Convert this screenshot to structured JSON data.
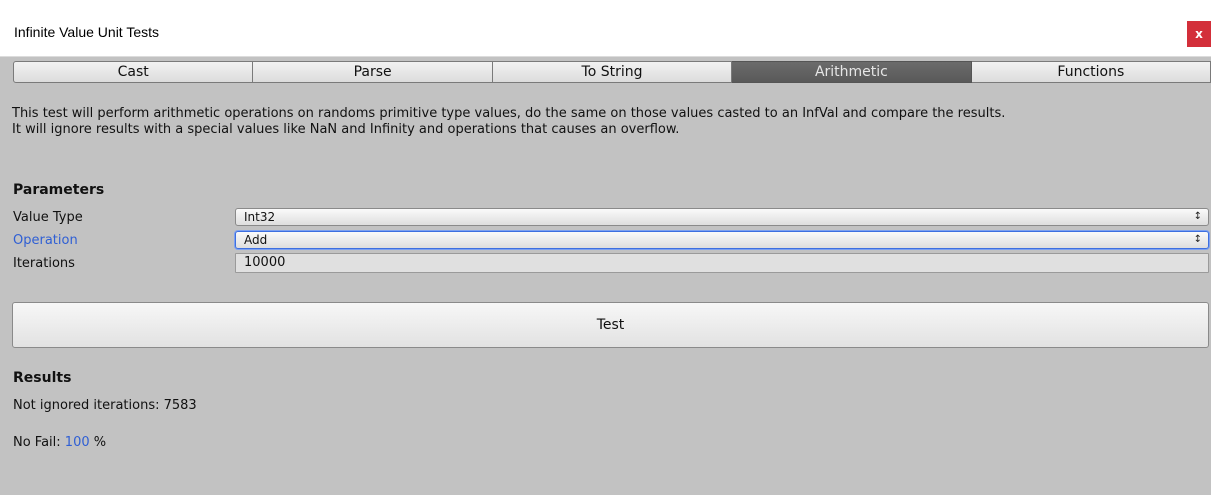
{
  "window": {
    "title": "Infinite Value Unit Tests",
    "close_label": "x"
  },
  "tabs": [
    {
      "label": "Cast",
      "active": false
    },
    {
      "label": "Parse",
      "active": false
    },
    {
      "label": "To String",
      "active": false
    },
    {
      "label": "Arithmetic",
      "active": true
    },
    {
      "label": "Functions",
      "active": false
    }
  ],
  "description": {
    "line1": "This test will perform arithmetic operations on randoms primitive type values, do the same on those values casted to an InfVal and compare the results.",
    "line2": "It will ignore results with a special values like NaN and Infinity and operations that causes an overflow."
  },
  "parameters": {
    "title": "Parameters",
    "value_type": {
      "label": "Value Type",
      "value": "Int32"
    },
    "operation": {
      "label": "Operation",
      "value": "Add"
    },
    "iterations": {
      "label": "Iterations",
      "value": "10000"
    }
  },
  "test_button": {
    "label": "Test"
  },
  "results": {
    "title": "Results",
    "not_ignored_label": "Not ignored iterations: 7583",
    "no_fail_prefix": "No Fail: ",
    "no_fail_value": "100",
    "no_fail_suffix": " %"
  },
  "colors": {
    "panel_bg": "#c2c2c2",
    "accent_blue": "#2f5fd4",
    "close_red": "#d32f3a",
    "active_tab": "#5f5f5f"
  },
  "icons": {
    "dropdown": "updown-arrow-icon",
    "close": "close-icon"
  }
}
